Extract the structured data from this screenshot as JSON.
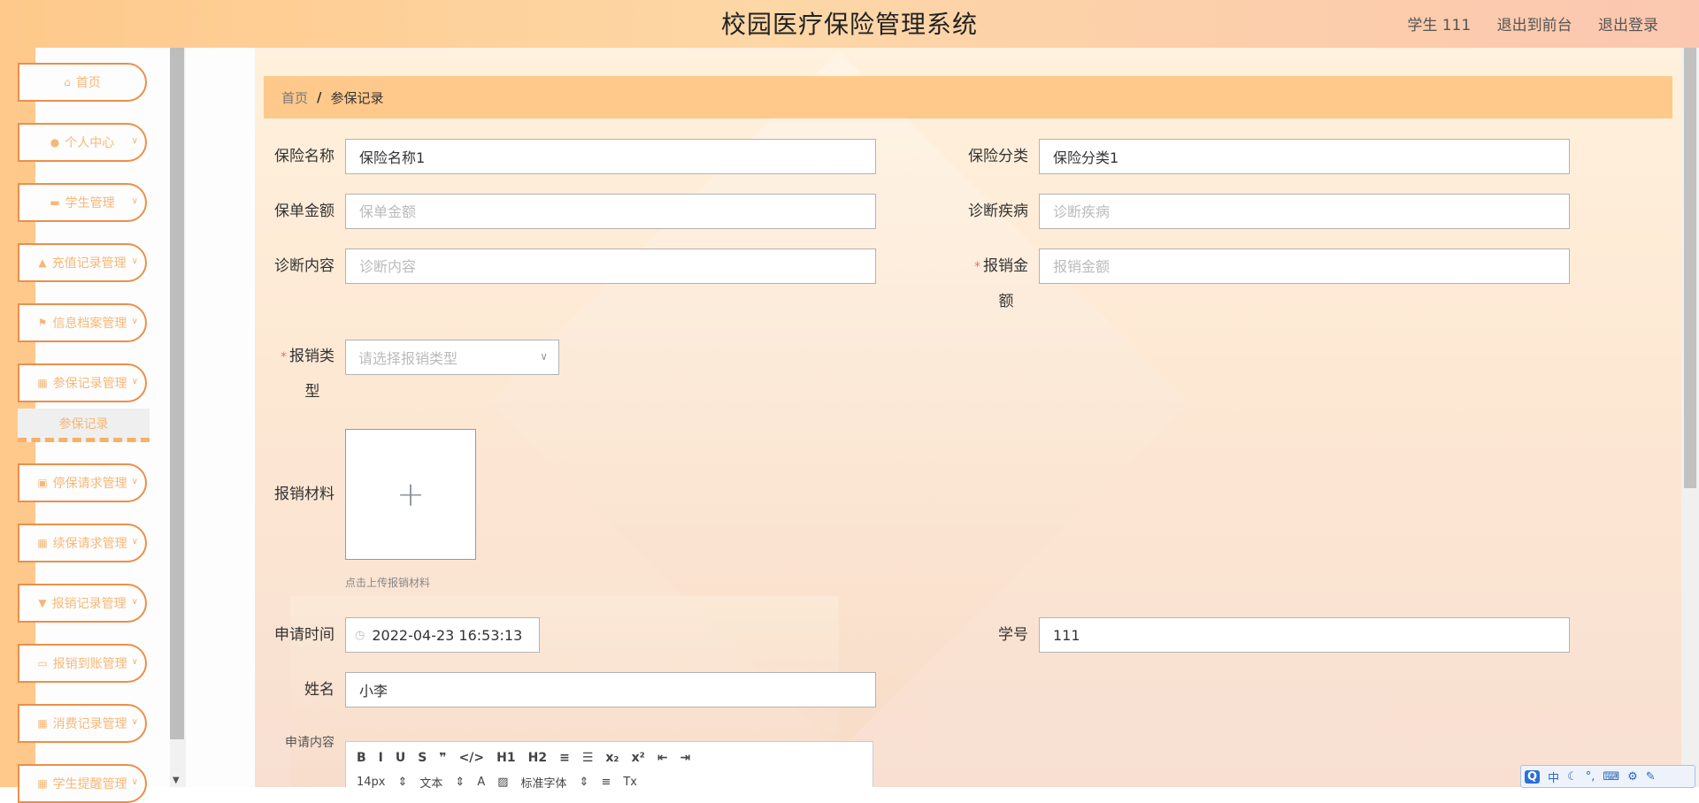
{
  "header": {
    "title": "校园医疗保险管理系统",
    "user": "学生 111",
    "to_front": "退出到前台",
    "logout": "退出登录"
  },
  "sidebar": {
    "items": [
      {
        "label": "首页",
        "icon": "home-icon"
      },
      {
        "label": "个人中心",
        "icon": "user-icon"
      },
      {
        "label": "学生管理",
        "icon": "briefcase-icon"
      },
      {
        "label": "充值记录管理",
        "icon": "thumbs-up-icon"
      },
      {
        "label": "信息档案管理",
        "icon": "flag-icon"
      },
      {
        "label": "参保记录管理",
        "icon": "grid-icon"
      },
      {
        "label": "停保请求管理",
        "icon": "clipboard-icon"
      },
      {
        "label": "续保请求管理",
        "icon": "grid-icon"
      },
      {
        "label": "报销记录管理",
        "icon": "stamp-icon"
      },
      {
        "label": "报销到账管理",
        "icon": "monitor-icon"
      },
      {
        "label": "消费记录管理",
        "icon": "grid-icon"
      },
      {
        "label": "学生提醒管理",
        "icon": "grid-icon"
      }
    ],
    "active_sub": "参保记录"
  },
  "breadcrumb": {
    "home": "首页",
    "sep": "/",
    "current": "参保记录"
  },
  "form": {
    "insurance_name": {
      "label": "保险名称",
      "value": "保险名称1"
    },
    "insurance_category": {
      "label": "保险分类",
      "value": "保险分类1"
    },
    "policy_amount": {
      "label": "保单金额",
      "placeholder": "保单金额"
    },
    "diagnosis_disease": {
      "label": "诊断疾病",
      "placeholder": "诊断疾病"
    },
    "diagnosis_content": {
      "label": "诊断内容",
      "placeholder": "诊断内容"
    },
    "reimburse_amount": {
      "label_line1": "报销金",
      "label_line2": "额",
      "placeholder": "报销金额"
    },
    "reimburse_type": {
      "label_line1": "报销类",
      "label_line2": "型",
      "placeholder": "请选择报销类型"
    },
    "reimburse_material": {
      "label": "报销材料",
      "hint": "点击上传报销材料"
    },
    "apply_time": {
      "label": "申请时间",
      "value": "2022-04-23 16:53:13"
    },
    "student_no": {
      "label": "学号",
      "value": "111"
    },
    "name": {
      "label": "姓名",
      "value": "小李"
    },
    "apply_content": {
      "label": "申请内容"
    }
  },
  "editor": {
    "row1": [
      "B",
      "I",
      "U",
      "S",
      "❞",
      "</>",
      "H1",
      "H2",
      "≡",
      "☰",
      "x₂",
      "x²",
      "⇤",
      "⇥"
    ],
    "font_size": "14px",
    "text_type": "文本",
    "font_family": "标准字体"
  },
  "ime": {
    "logo": "Q",
    "lang": "中"
  },
  "colors": {
    "accent": "#fec98b",
    "border_orange": "#ec8f4a",
    "menu_text": "#f7b777"
  }
}
